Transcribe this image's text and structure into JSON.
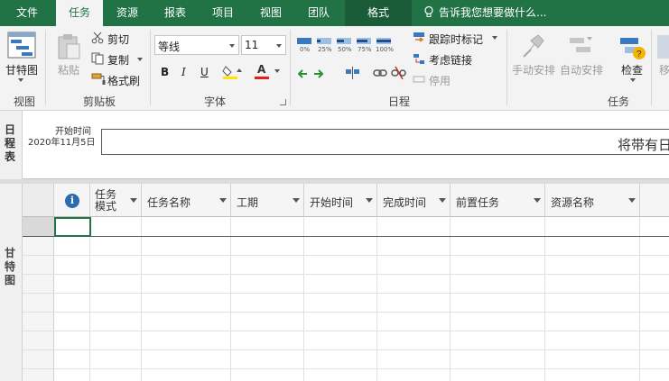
{
  "tabs": [
    "文件",
    "任务",
    "资源",
    "报表",
    "项目",
    "视图",
    "团队",
    "格式"
  ],
  "tell_me": "告诉我您想要做什么...",
  "ribbon": {
    "view": {
      "gantt_label": "甘特图",
      "group": "视图"
    },
    "clipboard": {
      "paste": "粘贴",
      "cut": "剪切",
      "copy": "复制",
      "format_painter": "格式刷",
      "group": "剪贴板"
    },
    "font": {
      "font_name": "等线",
      "font_size": "11",
      "bold": "B",
      "italic": "I",
      "underline": "U",
      "font_color_letter": "A",
      "group": "字体"
    },
    "schedule": {
      "pct": [
        "0%",
        "25%",
        "50%",
        "75%",
        "100%"
      ],
      "track": "跟踪时标记",
      "respect_links": "考虑链接",
      "inactivate": "停用",
      "group": "日程"
    },
    "tasks": {
      "manual": "手动安排",
      "auto": "自动安排",
      "inspect": "检查",
      "move": "移",
      "group": "任务"
    }
  },
  "timeline": {
    "side_label": "日程表",
    "start_label": "开始时间",
    "start_date": "2020年11月5日",
    "bar_text": "将带有日"
  },
  "gantt": {
    "side_label": "甘特图",
    "columns": [
      "任务模式",
      "任务名称",
      "工期",
      "开始时间",
      "完成时间",
      "前置任务",
      "资源名称"
    ],
    "col_mode_l1": "任务",
    "col_mode_l2": "模式"
  },
  "colors": {
    "accent": "#217346",
    "ribbon_bg": "#f3f3f3"
  }
}
